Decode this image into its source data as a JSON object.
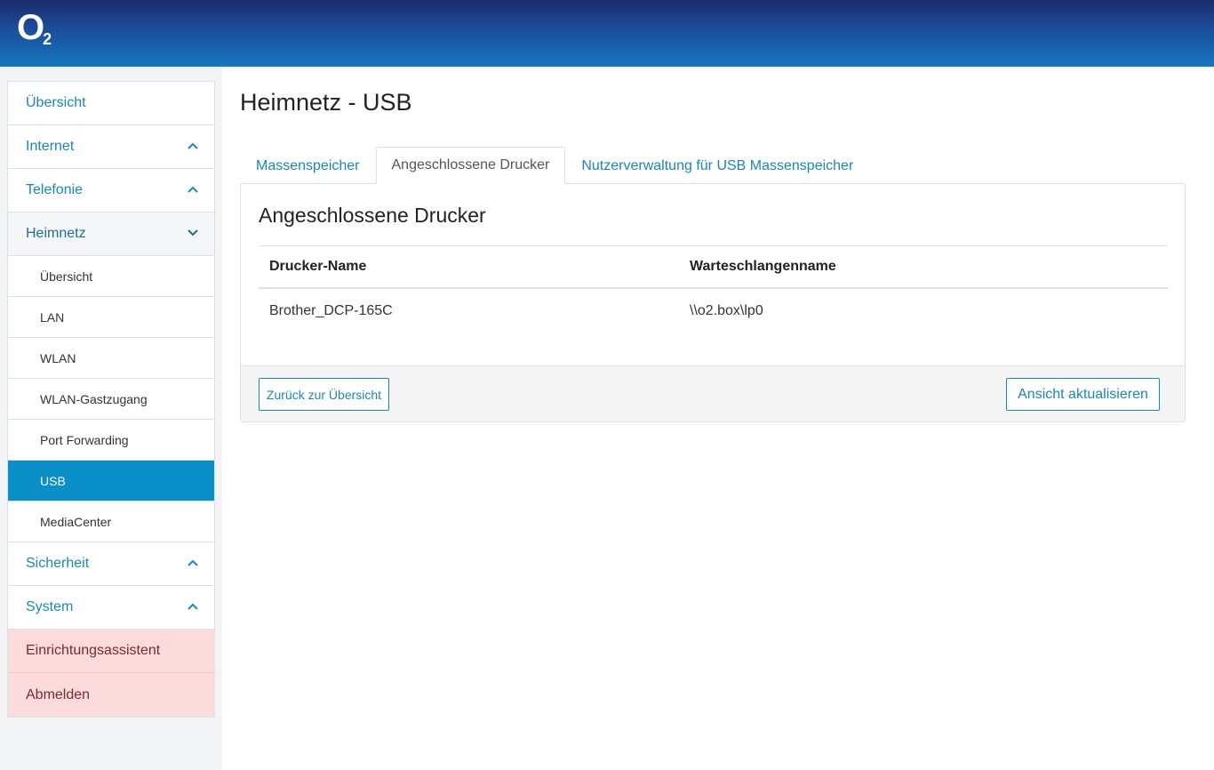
{
  "header": {
    "logo_text": "O",
    "logo_subscript": "2"
  },
  "sidebar": {
    "items": [
      {
        "label": "Übersicht",
        "expandable": false
      },
      {
        "label": "Internet",
        "expandable": true,
        "state": "collapsed"
      },
      {
        "label": "Telefonie",
        "expandable": true,
        "state": "collapsed"
      },
      {
        "label": "Heimnetz",
        "expandable": true,
        "state": "expanded",
        "children": [
          {
            "label": "Übersicht"
          },
          {
            "label": "LAN"
          },
          {
            "label": "WLAN"
          },
          {
            "label": "WLAN-Gastzugang"
          },
          {
            "label": "Port Forwarding"
          },
          {
            "label": "USB",
            "active": true
          },
          {
            "label": "MediaCenter"
          }
        ]
      },
      {
        "label": "Sicherheit",
        "expandable": true,
        "state": "collapsed"
      },
      {
        "label": "System",
        "expandable": true,
        "state": "collapsed"
      },
      {
        "label": "Einrichtungsassistent",
        "expandable": false,
        "style": "danger"
      },
      {
        "label": "Abmelden",
        "expandable": false,
        "style": "danger"
      }
    ]
  },
  "main": {
    "title": "Heimnetz - USB",
    "tabs": [
      {
        "label": "Massenspeicher",
        "active": false
      },
      {
        "label": "Angeschlossene Drucker",
        "active": true
      },
      {
        "label": "Nutzerverwaltung für USB Massenspeicher",
        "active": false
      }
    ],
    "panel": {
      "title": "Angeschlossene Drucker",
      "table": {
        "headers": [
          "Drucker-Name",
          "Warteschlangenname"
        ],
        "rows": [
          [
            "Brother_DCP-165C",
            "\\\\o2.box\\lp0"
          ]
        ]
      },
      "footer": {
        "back_label": "Zurück zur Übersicht",
        "refresh_label": "Ansicht aktualisieren"
      }
    }
  },
  "colors": {
    "accent": "#1789b8",
    "active_nav": "#0a8fc8",
    "danger_bg": "#fcdbdd",
    "header_dark": "#1c2b6e",
    "header_light": "#1676c0"
  },
  "icons": {
    "collapsed_indicator": "chevron-up-icon",
    "expanded_indicator": "chevron-down-icon"
  }
}
